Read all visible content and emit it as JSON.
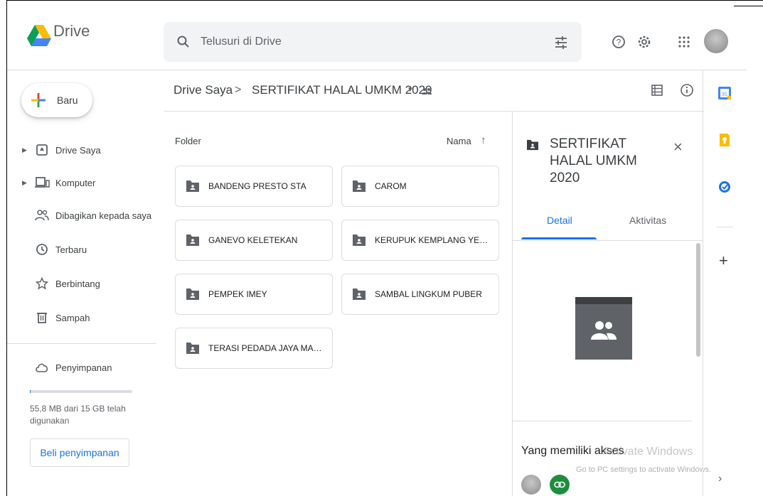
{
  "header": {
    "brand": "Drive",
    "search_placeholder": "Telusuri di Drive"
  },
  "sidebar": {
    "new_label": "Baru",
    "items": [
      {
        "label": "Drive Saya",
        "icon": "my-drive-icon",
        "expandable": true
      },
      {
        "label": "Komputer",
        "icon": "computer-icon",
        "expandable": true
      },
      {
        "label": "Dibagikan kepada saya",
        "icon": "shared-icon",
        "expandable": false
      },
      {
        "label": "Terbaru",
        "icon": "clock-icon",
        "expandable": false
      },
      {
        "label": "Berbintang",
        "icon": "star-icon",
        "expandable": false
      },
      {
        "label": "Sampah",
        "icon": "trash-icon",
        "expandable": false
      }
    ],
    "storage_label": "Penyimpanan",
    "storage_used_text": "55,8 MB dari 15 GB telah digunakan",
    "storage_used_fraction": 0.0037,
    "buy_label": "Beli penyimpanan"
  },
  "breadcrumb": {
    "root": "Drive Saya",
    "separator": ">",
    "current": "SERTIFIKAT HALAL UMKM 2020"
  },
  "list": {
    "section_label": "Folder",
    "sort_label": "Nama",
    "folders": [
      "BANDENG PRESTO STA",
      "CAROM",
      "GANEVO KELETEKAN",
      "KERUPUK KEMPLANG YENSI BA...",
      "PEMPEK IMEY",
      "SAMBAL LINGKUM PUBER",
      "TERASI PEDADA JAYA MANDIRI"
    ]
  },
  "details": {
    "title": "SERTIFIKAT HALAL UMKM 2020",
    "tabs": [
      "Detail",
      "Aktivitas"
    ],
    "active_tab": "Detail",
    "access_title": "Yang memiliki akses"
  },
  "watermark": {
    "line1": "Activate Windows",
    "line2": "Go to PC settings to activate Windows."
  },
  "colors": {
    "accent": "#1a73e8",
    "folder": "#5f6368",
    "link_green": "#1e8e3e"
  }
}
